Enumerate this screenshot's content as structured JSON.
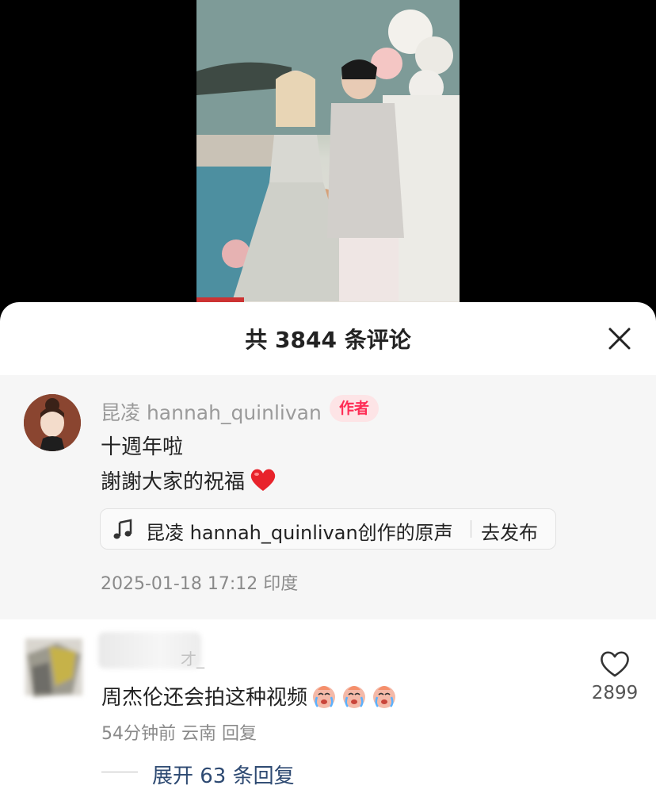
{
  "sheet": {
    "title": "共 3844 条评论",
    "close_icon": "close-icon"
  },
  "author_comment": {
    "name": "昆凌 hannah_quinlivan",
    "badge": "作者",
    "line1": "十週年啦",
    "line2": "謝謝大家的祝福",
    "emoji": "red-heart",
    "music": {
      "icon": "music-note-icon",
      "label": "昆凌 hannah_quinlivan创作的原声",
      "action": "去发布"
    },
    "meta": "2025-01-18 17:12 印度"
  },
  "comment": {
    "name_visible": "才_",
    "text": "周杰伦还会拍这种视频",
    "emoji": "crying-face",
    "time": "54分钟前",
    "location": "云南",
    "reply": "回复",
    "likes": "2899",
    "expand": "展开 63 条回复"
  },
  "colors": {
    "accent": "#fe2c55",
    "badge_bg": "#fde4e6",
    "link": "#2e4a72",
    "gray_text": "#8a8a8a"
  }
}
